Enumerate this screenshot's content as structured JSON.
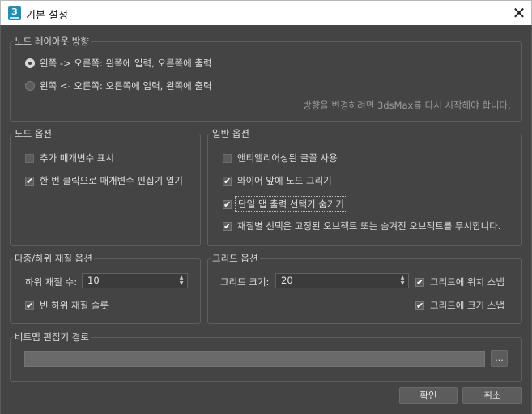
{
  "window": {
    "title": "기본 설정",
    "close_glyph": "✕",
    "app_icon_text": "3"
  },
  "layout_group": {
    "label": "노드 레이아웃 방향",
    "options": [
      {
        "label": "왼쪽 -> 오른쪽: 왼쪽에 입력, 오른쪽에 출력",
        "selected": true
      },
      {
        "label": "왼쪽 <- 오른쪽: 오른쪽에 입력, 왼쪽에 출력",
        "selected": false
      }
    ],
    "hint": "방향을 변경하려면 3dsMax를 다시 시작해야 합니다."
  },
  "node_options": {
    "label": "노드 옵션",
    "items": [
      {
        "label": "추가 매개변수 표시",
        "checked": false
      },
      {
        "label": "한 번 클릭으로 매개변수 편집기 열기",
        "checked": true
      }
    ]
  },
  "general_options": {
    "label": "일반 옵션",
    "items": [
      {
        "label": "앤티앨리어싱된 글꼴 사용",
        "checked": false
      },
      {
        "label": "와이어 앞에 노드 그리기",
        "checked": true
      },
      {
        "label": "단일 맵 출력 선택기 숨기기",
        "checked": true
      },
      {
        "label": "재질별 선택은 고정된 오브젝트 또는 숨겨진 오브젝트를 무시합니다.",
        "checked": true
      }
    ]
  },
  "multi_material": {
    "label": "다중/하위 재질 옵션",
    "count_label": "하위 재질 수:",
    "count_value": "10",
    "empty_slots": {
      "label": "빈 하위 재질 슬롯",
      "checked": true
    }
  },
  "grid_options": {
    "label": "그리드 옵션",
    "size_label": "그리드 크기:",
    "size_value": "20",
    "snap_position": {
      "label": "그리드에 위치 스냅",
      "checked": true
    },
    "snap_size": {
      "label": "그리드에 크기 스냅",
      "checked": true
    }
  },
  "bitmap_editor": {
    "label": "비트맵 편집기 경로",
    "path": "",
    "browse_label": "..."
  },
  "buttons": {
    "ok": "확인",
    "cancel": "취소"
  },
  "colors": {
    "background": "#444444",
    "group_border": "#5e5e5e",
    "text": "#dcdcdc",
    "hint": "#9c9c9c"
  }
}
